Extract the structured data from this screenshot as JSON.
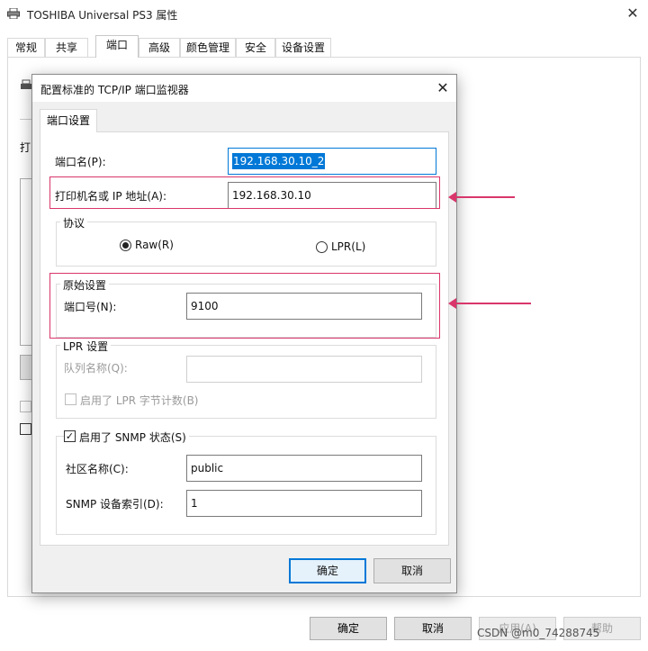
{
  "parent": {
    "title": "TOSHIBA Universal PS3 属性",
    "tabs": [
      "常规",
      "共享",
      "端口",
      "高级",
      "颜色管理",
      "安全",
      "设备设置"
    ],
    "partial_label": "打",
    "buttons": {
      "ok": "确定",
      "cancel": "取消",
      "apply": "应用(A)",
      "help": "帮助"
    }
  },
  "dialog": {
    "title": "配置标准的 TCP/IP 端口监视器",
    "tab": "端口设置",
    "port_name_label": "端口名(P):",
    "port_name_value": "192.168.30.10_2",
    "printer_ip_label": "打印机名或 IP 地址(A):",
    "printer_ip_value": "192.168.30.10",
    "protocol_group": "协议",
    "raw_label": "Raw(R)",
    "lpr_label": "LPR(L)",
    "raw_settings_group": "原始设置",
    "port_number_label": "端口号(N):",
    "port_number_value": "9100",
    "lpr_settings_group": "LPR 设置",
    "queue_name_label": "队列名称(Q):",
    "queue_name_value": "",
    "lpr_byte_count_label": "启用了 LPR 字节计数(B)",
    "snmp_label": "启用了 SNMP 状态(S)",
    "community_label": "社区名称(C):",
    "community_value": "public",
    "snmp_index_label": "SNMP 设备索引(D):",
    "snmp_index_value": "1",
    "ok_label": "确定",
    "cancel_label": "取消"
  },
  "watermark": "CSDN @m0_74288745",
  "colors": {
    "accent": "#0078d7",
    "highlight": "#d9366b"
  }
}
